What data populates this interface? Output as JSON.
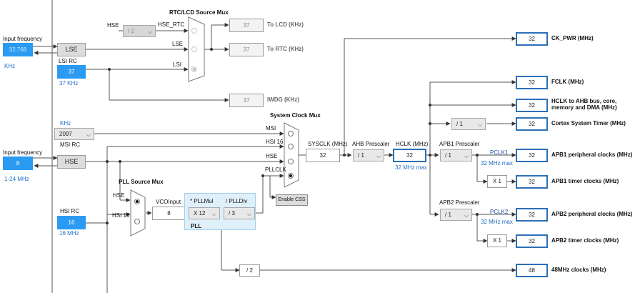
{
  "labels": {
    "input_frequency_lse": "Input frequency",
    "khz_unit_lse": "KHz",
    "lsi_rc": "LSI RC",
    "lsi_khz": "37 KHz",
    "rtc_lcd_mux": "RTC/LCD Source Mux",
    "hse_in": "HSE",
    "hse_rtc": "HSE_RTC",
    "lse_in": "LSE",
    "lsi_in": "LSI",
    "to_lcd": "To LCD (KHz)",
    "to_rtc": "To RTC (KHz)",
    "iwdg": "IWDG (KHz)",
    "msi_khz": "KHz",
    "msi_rc": "MSI RC",
    "input_frequency_hse": "Input frequency",
    "hse_range": "1-24 MHz",
    "system_clock_mux": "System Clock Mux",
    "msi_in": "MSI",
    "hsi16_in": "HSI 16",
    "hse_sys_in": "HSE",
    "pllclk_in": "PLLCLK",
    "pll_source_mux": "PLL Source Mux",
    "pll_hse": "HSE",
    "pll_hsi16": "HSI 16",
    "hsi_rc": "HSI RC",
    "hsi_mhz": "16 MHz",
    "vco_input": "VCOInput",
    "pllmul": "* PLLMul",
    "plldiv": "/ PLLDiv",
    "pll": "PLL",
    "sysclk_mhz": "SYSCLK (MHz)",
    "ahb_prescaler": "AHB Prescaler",
    "hclk_mhz": "HCLK (MHz)",
    "hclk_max": "32 MHz max",
    "apb1_prescaler": "APB1 Prescaler",
    "pclk1": "PCLK1",
    "pclk1_max": "32 MHz max",
    "apb2_prescaler": "APB2 Prescaler",
    "pclk2": "PCLK2",
    "pclk2_max": "32 MHz max"
  },
  "sources": {
    "lse_value": "32.768",
    "lse_label": "LSE",
    "lsi_value": "37",
    "msi_value": "2097",
    "hse_value": "8",
    "hse_label": "HSE",
    "hsi_value": "16"
  },
  "dividers": {
    "hse_rtc_div": "/ 2",
    "pll_mul": "X 12",
    "pll_div": "/ 3",
    "ahb_div": "/ 1",
    "apb1_div": "/ 1",
    "apb2_div": "/ 1",
    "cortex_div": "/ 1",
    "apb1_timer_mul": "X 1",
    "apb2_timer_mul": "X 1",
    "usb_div": "/ 2"
  },
  "values": {
    "to_lcd": "37",
    "to_rtc": "37",
    "iwdg": "37",
    "vco_input": "8",
    "sysclk": "32",
    "hclk": "32",
    "ck_pwr": "32",
    "fclk": "32",
    "hclk_ahb": "32",
    "cortex_timer": "32",
    "apb1_peripheral": "32",
    "apb1_timer": "32",
    "apb2_peripheral": "32",
    "apb2_timer": "32",
    "usb_48": "48"
  },
  "outputs": {
    "ck_pwr": "CK_PWR (MHz)",
    "fclk": "FCLK (MHz)",
    "hclk_ahb_line1": "HCLK to AHB bus, core,",
    "hclk_ahb_line2": "memory and DMA (MHz)",
    "cortex_timer": "Cortex System Timer (MHz)",
    "apb1_peripheral": "APB1 peripheral clocks (MHz)",
    "apb1_timer": "APB1 timer clocks (MHz)",
    "apb2_peripheral": "APB2 peripheral clocks (MHz)",
    "apb2_timer": "APB2 timer clocks (MHz)",
    "usb_48": "48MHz clocks (MHz)"
  },
  "buttons": {
    "enable_css": "Enable CSS"
  },
  "colors": {
    "accent_blue": "#2a9bf1",
    "link_blue": "#1f6fc4",
    "pll_panel": "#dff0fa"
  }
}
